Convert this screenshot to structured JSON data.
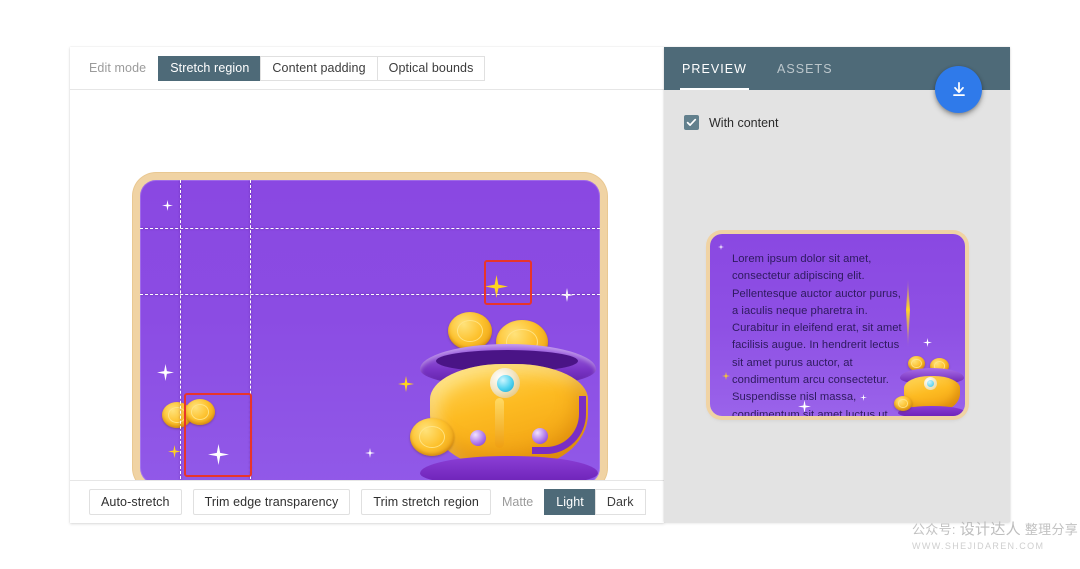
{
  "left_panel": {
    "edit_mode_label": "Edit mode",
    "edit_mode_tabs": [
      {
        "label": "Stretch region",
        "active": true
      },
      {
        "label": "Content padding",
        "active": false
      },
      {
        "label": "Optical bounds",
        "active": false
      }
    ],
    "bottom_toolbar": {
      "buttons": [
        {
          "label": "Auto-stretch"
        },
        {
          "label": "Trim edge transparency"
        },
        {
          "label": "Trim stretch region"
        }
      ],
      "matte_label": "Matte",
      "matte_options": [
        {
          "label": "Light",
          "active": true
        },
        {
          "label": "Dark",
          "active": false
        }
      ]
    }
  },
  "right_panel": {
    "tabs": [
      {
        "label": "PREVIEW",
        "active": true
      },
      {
        "label": "ASSETS",
        "active": false
      }
    ],
    "with_content": {
      "label": "With content",
      "checked": true
    },
    "preview_text": "Lorem ipsum dolor sit amet, consectetur adipiscing elit. Pellentesque auctor auctor purus, a iaculis neque pharetra in. Curabitur in eleifend erat, sit amet facilisis augue. In hendrerit lectus sit amet purus auctor, at condimentum arcu consectetur. Suspendisse nisl massa, condimentum sit amet luctus ut, euismod id lacus."
  },
  "download_button": {
    "icon": "download-icon"
  },
  "watermark": {
    "line1_prefix": "公众号: ",
    "line1_brand": "设计达人",
    "line1_suffix": " 整理分享",
    "line2": "WWW.SHEJIDAREN.COM"
  },
  "colors": {
    "accent_slate": "#4e6a78",
    "fab_blue": "#2f7aea",
    "selection_red": "#e8352a",
    "card_purple": "#8b4ce3",
    "card_gold_border": "#f0d3a4",
    "right_panel_bg": "#e3e3e3"
  }
}
